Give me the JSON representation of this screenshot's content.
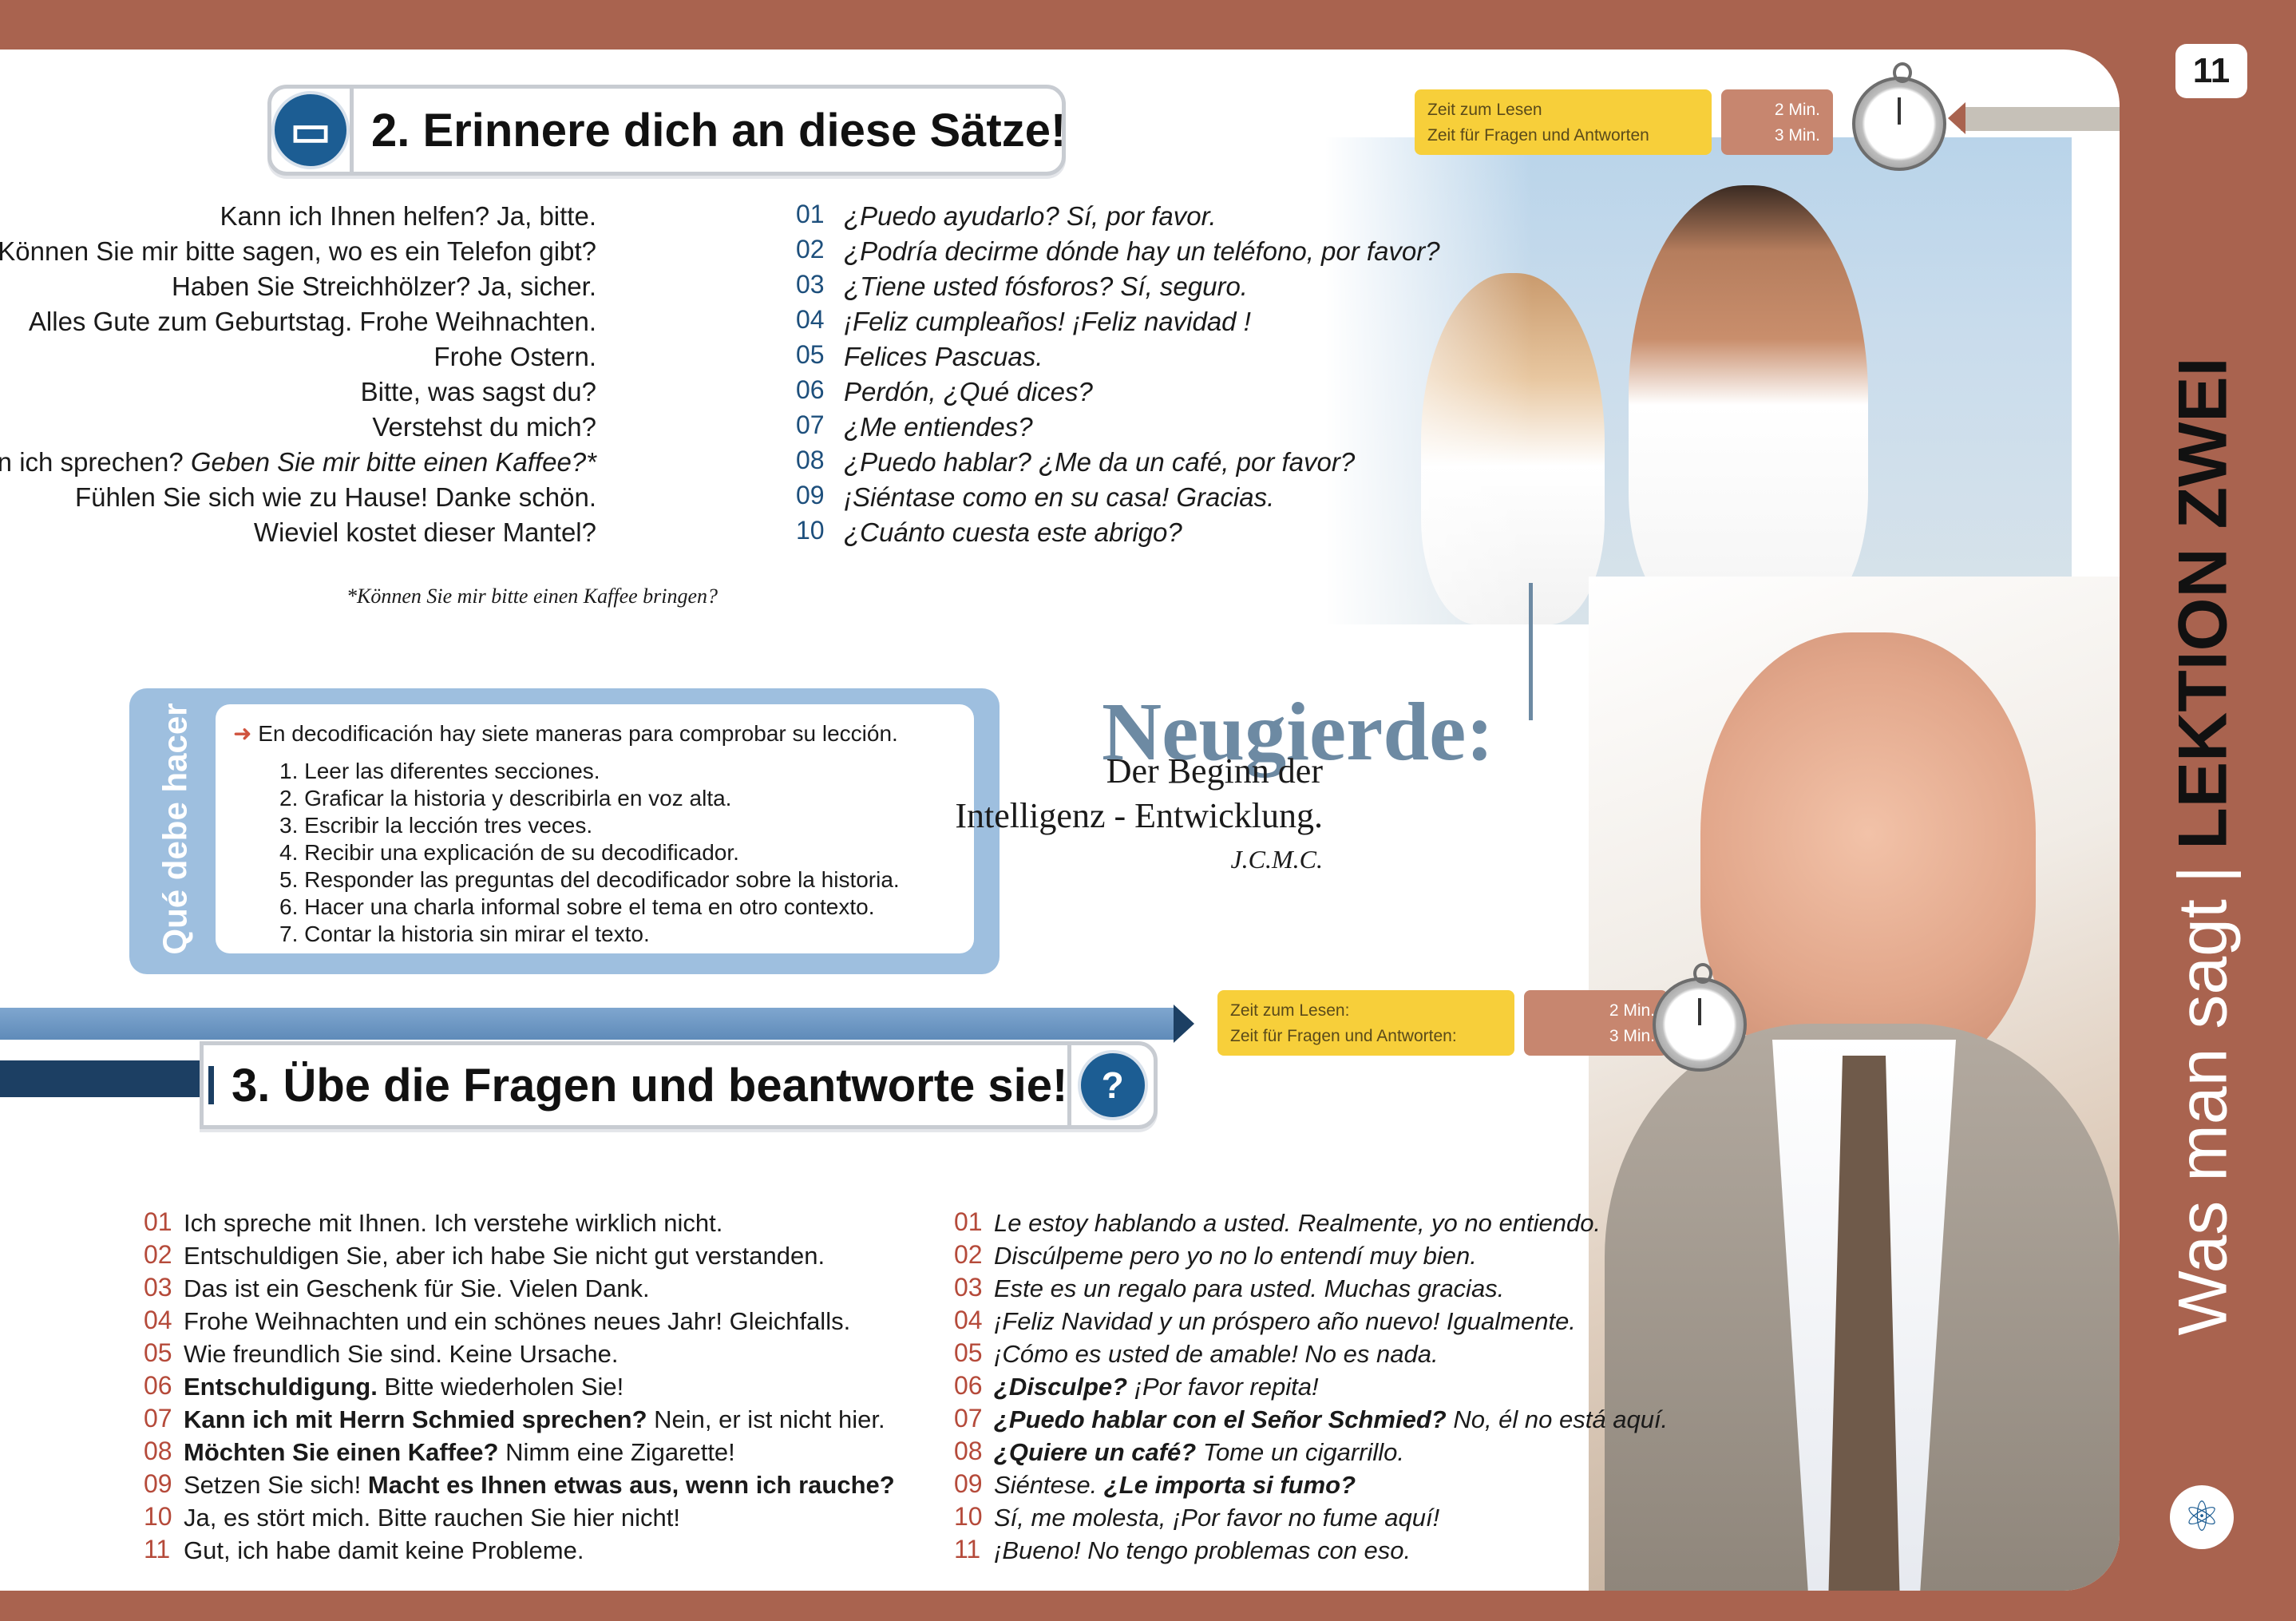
{
  "page_number": "11",
  "side_title": {
    "light": "Was man sagt",
    "separator": "|",
    "bold": "LEKTION ZWEI"
  },
  "section2": {
    "title": "2. Erinnere dich an diese Sätze!",
    "rows": [
      {
        "num": "01",
        "de": "Kann ich Ihnen helfen? Ja, bitte.",
        "es": "¿Puedo ayudarlo? Sí, por favor."
      },
      {
        "num": "02",
        "de": "Können Sie mir bitte sagen, wo es ein Telefon gibt?",
        "es": "¿Podría decirme dónde hay un teléfono, por favor?"
      },
      {
        "num": "03",
        "de": "Haben Sie Streichhölzer? Ja, sicher.",
        "es": "¿Tiene usted fósforos? Sí, seguro."
      },
      {
        "num": "04",
        "de": "Alles Gute zum Geburtstag. Frohe Weihnachten.",
        "es": "¡Feliz cumpleaños! ¡Feliz navidad !"
      },
      {
        "num": "05",
        "de": "Frohe Ostern.",
        "es": "Felices Pascuas."
      },
      {
        "num": "06",
        "de": "Bitte, was sagst du?",
        "es": "Perdón, ¿Qué dices?"
      },
      {
        "num": "07",
        "de": "Verstehst du mich?",
        "es": "¿Me entiendes?"
      },
      {
        "num": "08",
        "de_plain": "Kann ich sprechen? ",
        "de_italic": "Geben Sie mir bitte einen Kaffee?*",
        "es": "¿Puedo hablar? ¿Me da un café, por favor?"
      },
      {
        "num": "09",
        "de": "Fühlen Sie sich wie zu Hause! Danke schön.",
        "es": "¡Siéntase como en su casa! Gracias."
      },
      {
        "num": "10",
        "de": "Wieviel kostet dieser Mantel?",
        "es": "¿Cuánto cuesta este abrigo?"
      }
    ],
    "footnote": "*Können Sie mir bitte einen Kaffee bringen?",
    "timer": {
      "read_label": "Zeit zum Lesen",
      "qa_label": "Zeit für Fragen und Antworten",
      "read_time": "2 Min.",
      "qa_time": "3 Min."
    }
  },
  "que_debe_hacer": {
    "label": "Qué debe hacer",
    "intro": "En decodificación hay siete maneras para comprobar su lección.",
    "items": [
      "1.  Leer las diferentes secciones.",
      "2.  Graficar la historia y describirla en voz alta.",
      "3.  Escribir la lección tres veces.",
      "4.  Recibir una explicación de su decodificador.",
      "5.  Responder las preguntas del decodificador sobre la historia.",
      "6.  Hacer una charla informal sobre el tema en otro contexto.",
      "7.  Contar la historia sin mirar el texto."
    ]
  },
  "quote": {
    "title": "Neugierde:",
    "line1": "Der Beginn der",
    "line2": "Intelligenz - Entwicklung.",
    "author": "J.C.M.C."
  },
  "section3": {
    "title": "3. Übe die Fragen und beantworte sie!",
    "timer": {
      "read_label": "Zeit zum Lesen:",
      "qa_label": "Zeit für Fragen und Antworten:",
      "read_time": "2 Min.",
      "qa_time": "3 Min."
    },
    "de_rows": [
      {
        "num": "01",
        "b": "",
        "t": "Ich spreche mit Ihnen. Ich verstehe wirklich nicht."
      },
      {
        "num": "02",
        "b": "",
        "t": "Entschuldigen Sie, aber ich habe Sie nicht gut verstanden."
      },
      {
        "num": "03",
        "b": "",
        "t": "Das ist ein Geschenk für Sie. Vielen Dank."
      },
      {
        "num": "04",
        "b": "",
        "t": "Frohe Weihnachten und ein schönes neues Jahr! Gleichfalls."
      },
      {
        "num": "05",
        "b": "",
        "t": "Wie freundlich Sie sind. Keine Ursache."
      },
      {
        "num": "06",
        "b": "Entschuldigung.",
        "t": " Bitte wiederholen Sie!"
      },
      {
        "num": "07",
        "b": "Kann ich mit Herrn Schmied sprechen?",
        "t": " Nein, er ist nicht hier."
      },
      {
        "num": "08",
        "b": "Möchten Sie einen Kaffee?",
        "t": " Nimm eine Zigarette!"
      },
      {
        "num": "09",
        "pre": "Setzen Sie sich! ",
        "b": "Macht es Ihnen etwas aus, wenn ich rauche?",
        "t": ""
      },
      {
        "num": "10",
        "b": "",
        "t": "Ja, es stört mich. Bitte rauchen Sie hier nicht!"
      },
      {
        "num": "11",
        "b": "",
        "t": "Gut, ich habe damit keine Probleme."
      }
    ],
    "es_rows": [
      {
        "num": "01",
        "b": "",
        "t": "Le estoy hablando a usted. Realmente, yo no entiendo."
      },
      {
        "num": "02",
        "b": "",
        "t": "Discúlpeme pero yo no lo entendí muy bien."
      },
      {
        "num": "03",
        "b": "",
        "t": "Este es un regalo para usted. Muchas gracias."
      },
      {
        "num": "04",
        "b": "",
        "t": "¡Feliz Navidad y un próspero año nuevo! Igualmente."
      },
      {
        "num": "05",
        "b": "",
        "t": "¡Cómo es usted de amable! No es nada."
      },
      {
        "num": "06",
        "b": "¿Disculpe?",
        "t": " ¡Por favor repita!"
      },
      {
        "num": "07",
        "b": "¿Puedo hablar con el Señor Schmied?",
        "t": " No, él no está aquí."
      },
      {
        "num": "08",
        "b": "¿Quiere un café?",
        "t": " Tome un cigarrillo."
      },
      {
        "num": "09",
        "pre": "Siéntese. ",
        "b": "¿Le importa si fumo?",
        "t": ""
      },
      {
        "num": "10",
        "b": "",
        "t": "Sí, me molesta, ¡Por favor no fume aquí!"
      },
      {
        "num": "11",
        "b": "",
        "t": "¡Bueno! No tengo problemas con eso."
      }
    ]
  },
  "colors": {
    "border": "#a9634f",
    "accent_blue": "#1c5d93",
    "timer_yellow": "#f7cf3a",
    "timer_brown": "#c7866f",
    "box_blue": "#9ebfdf"
  }
}
